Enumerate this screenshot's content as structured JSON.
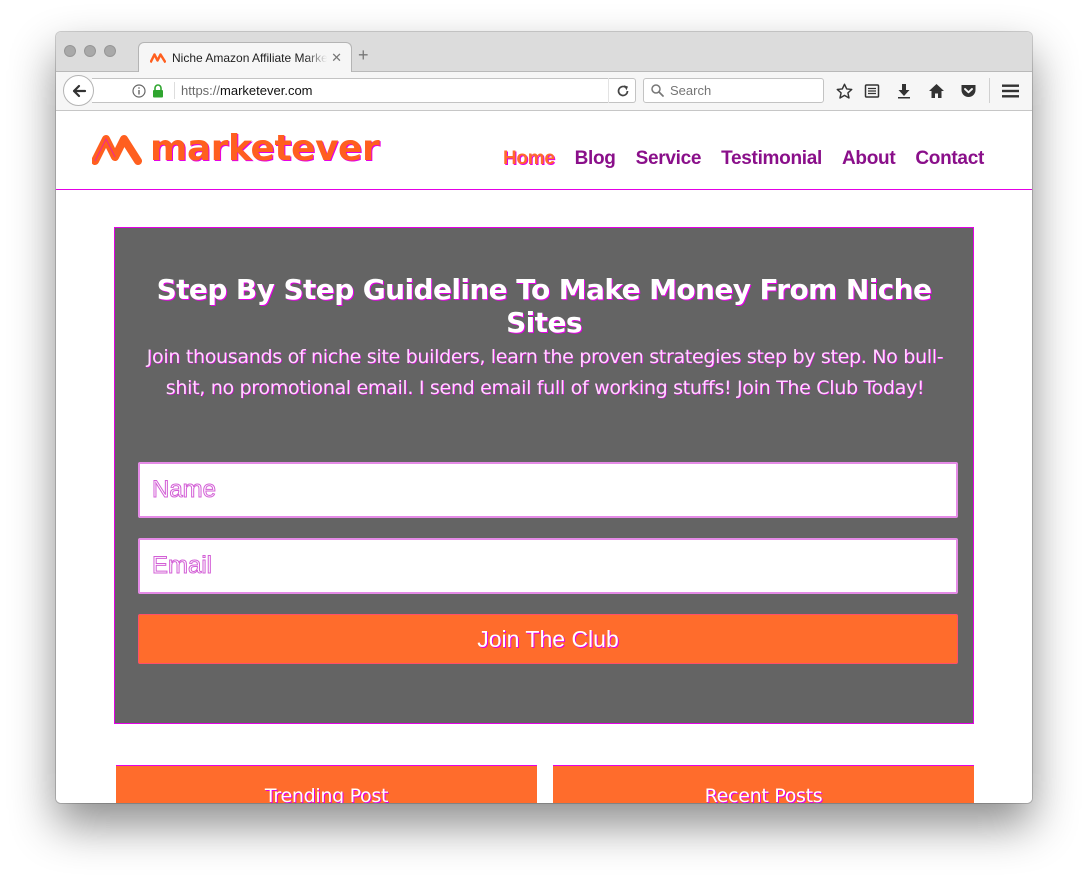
{
  "browser": {
    "tab_title": "Niche Amazon Affiliate Marketing",
    "url_protocol": "https://",
    "url_host": "marketever.com",
    "search_placeholder": "Search"
  },
  "site": {
    "logo_text": "marketever",
    "nav": [
      {
        "label": "Home",
        "active": true
      },
      {
        "label": "Blog"
      },
      {
        "label": "Service"
      },
      {
        "label": "Testimonial"
      },
      {
        "label": "About"
      },
      {
        "label": "Contact"
      }
    ]
  },
  "optin": {
    "heading": "Step By Step Guideline To Make Money From Niche Sites",
    "description": "Join thousands of niche site builders, learn the proven strategies step by step. No bull-shit, no promotional email. I send email full of working stuffs! Join The Club Today!",
    "name_placeholder": "Name",
    "email_placeholder": "Email",
    "button_label": "Join The Club"
  },
  "widgets": {
    "left_title": "Trending Post",
    "right_title": "Recent Posts"
  },
  "colors": {
    "brand_orange": "#ff6c2c",
    "nav_purple": "#8a0f8a",
    "accent_magenta": "#e400e6",
    "panel_gray": "#646464"
  }
}
